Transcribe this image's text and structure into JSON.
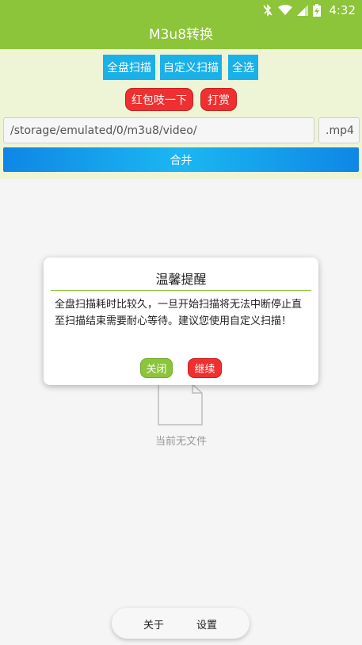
{
  "status_bar": {
    "time": "4:32"
  },
  "app_bar": {
    "title": "M3u8转换"
  },
  "scan_buttons": {
    "full_scan": "全盘扫描",
    "custom_scan": "自定义扫描",
    "select_all": "全选"
  },
  "promo_buttons": {
    "red_packet": "红包吱一下",
    "reward": "打赏"
  },
  "inputs": {
    "path_value": "/storage/emulated/0/m3u8/video/",
    "extension_value": ".mp4"
  },
  "merge_button": {
    "label": "合并"
  },
  "empty_state": {
    "text": "当前无文件"
  },
  "dialog": {
    "title": "温馨提醒",
    "message": "全盘扫描耗时比较久，一旦开始扫描将无法中断停止直至扫描结束需要耐心等待。建议您使用自定义扫描！",
    "close_label": "关闭",
    "continue_label": "继续"
  },
  "bottom_nav": {
    "about": "关于",
    "settings": "设置"
  },
  "colors": {
    "primary": "#8cc43a",
    "accent_blue": "#1ab0e8",
    "accent_red": "#f03030",
    "panel_bg": "#eef5d6"
  }
}
